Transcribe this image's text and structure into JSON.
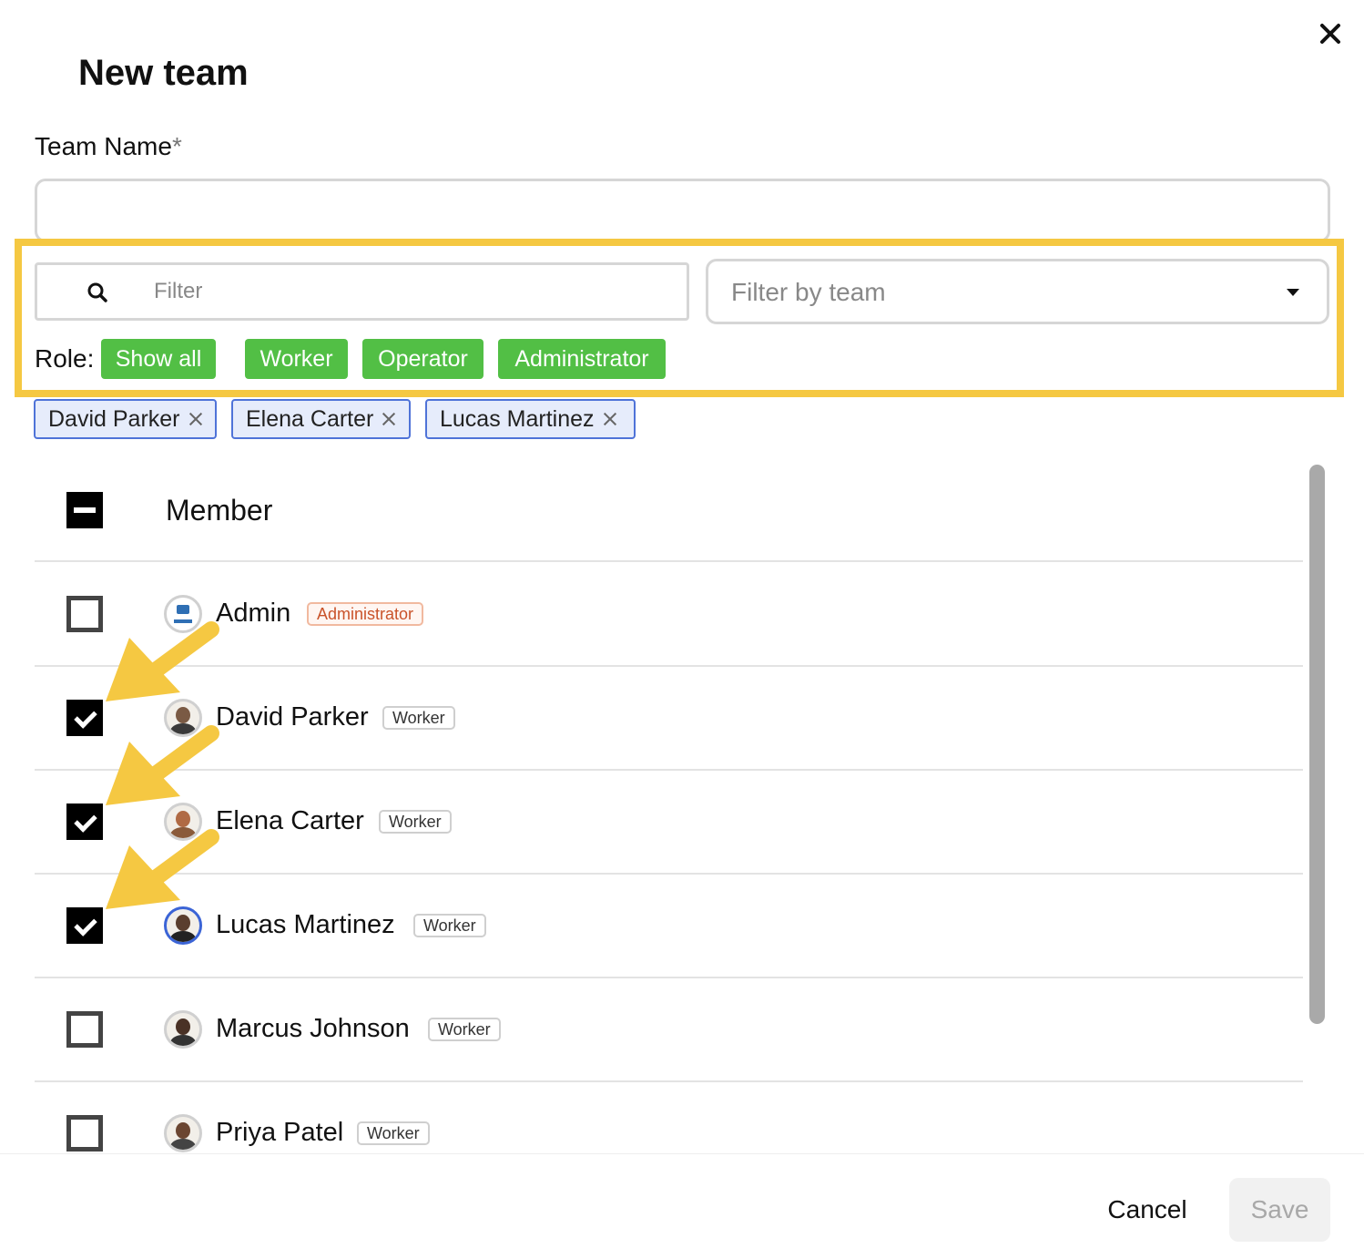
{
  "dialog": {
    "title": "New team",
    "close_icon": "close-icon"
  },
  "team_name": {
    "label": "Team Name",
    "required_mark": "*",
    "value": "",
    "placeholder": ""
  },
  "filter": {
    "placeholder": "Filter",
    "value": "",
    "icon": "search-icon"
  },
  "team_filter": {
    "placeholder": "Filter by team",
    "icon": "chevron-down-icon"
  },
  "roles": {
    "label": "Role:",
    "options": [
      "Show all",
      "Worker",
      "Operator",
      "Administrator"
    ]
  },
  "selected_chips": [
    "David Parker",
    "Elena Carter",
    "Lucas Martinez"
  ],
  "list": {
    "header": "Member",
    "header_checkbox_state": "indeterminate",
    "members": [
      {
        "name": "Admin",
        "role": "Administrator",
        "checked": false
      },
      {
        "name": "David Parker",
        "role": "Worker",
        "checked": true
      },
      {
        "name": "Elena Carter",
        "role": "Worker",
        "checked": true
      },
      {
        "name": "Lucas Martinez",
        "role": "Worker",
        "checked": true
      },
      {
        "name": "Marcus Johnson",
        "role": "Worker",
        "checked": false
      },
      {
        "name": "Priya Patel",
        "role": "Worker",
        "checked": false
      }
    ]
  },
  "footer": {
    "cancel_label": "Cancel",
    "save_label": "Save"
  },
  "colors": {
    "role_button": "#52bf45",
    "chip_border": "#4f73d8",
    "chip_bg": "#e6ecfb",
    "highlight": "#f5c842",
    "admin_badge_text": "#c9532a"
  }
}
